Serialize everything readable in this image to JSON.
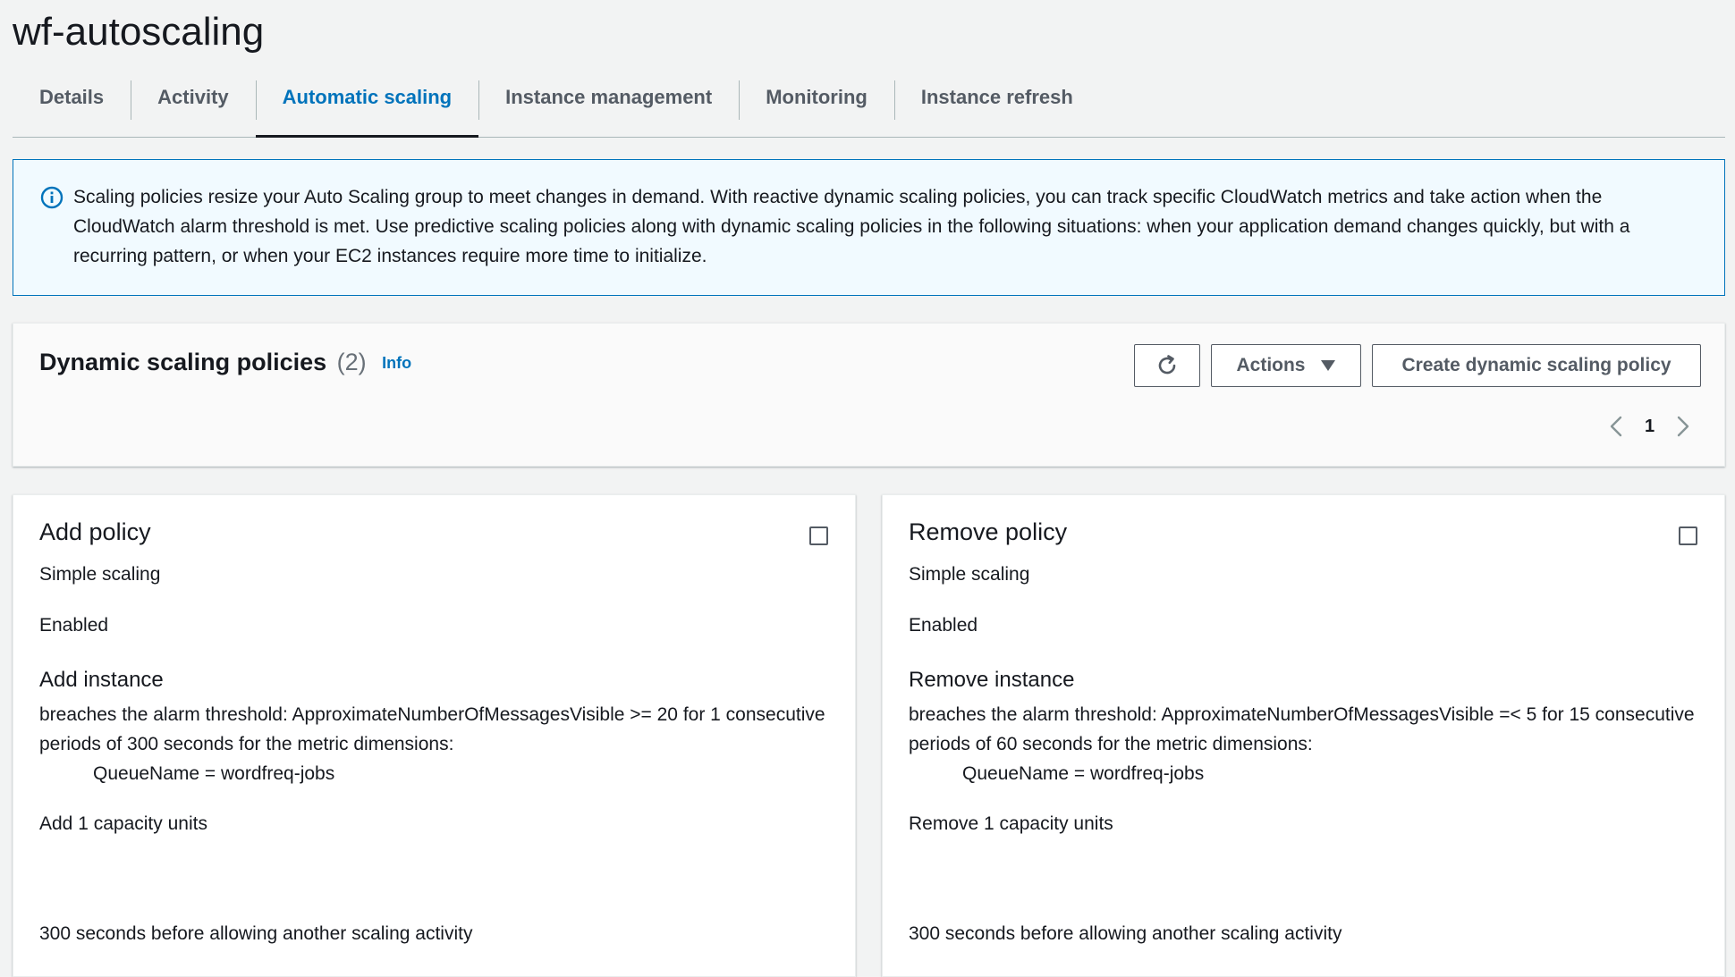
{
  "page": {
    "title": "wf-autoscaling"
  },
  "tabs": [
    {
      "label": "Details",
      "active": false
    },
    {
      "label": "Activity",
      "active": false
    },
    {
      "label": "Automatic scaling",
      "active": true
    },
    {
      "label": "Instance management",
      "active": false
    },
    {
      "label": "Monitoring",
      "active": false
    },
    {
      "label": "Instance refresh",
      "active": false
    }
  ],
  "info_alert": {
    "icon": "info-circle-icon",
    "text": "Scaling policies resize your Auto Scaling group to meet changes in demand. With reactive dynamic scaling policies, you can track specific CloudWatch metrics and take action when the CloudWatch alarm threshold is met. Use predictive scaling policies along with dynamic scaling policies in the following situations: when your application demand changes quickly, but with a recurring pattern, or when your EC2 instances require more time to initialize."
  },
  "policies_header": {
    "title": "Dynamic scaling policies",
    "count": "(2)",
    "info_link": "Info",
    "refresh_icon": "refresh-icon",
    "actions_label": "Actions",
    "create_label": "Create dynamic scaling policy",
    "pagination": {
      "current_page": "1"
    }
  },
  "policies": [
    {
      "title": "Add policy",
      "type": "Simple scaling",
      "status": "Enabled",
      "action_title": "Add instance",
      "breach_text": "breaches the alarm threshold: ApproximateNumberOfMessagesVisible >= 20 for 1 consecutive periods of 300 seconds for the metric dimensions:",
      "dimension": "QueueName = wordfreq-jobs",
      "capacity": "Add 1 capacity units",
      "cooldown": "300 seconds before allowing another scaling activity"
    },
    {
      "title": "Remove policy",
      "type": "Simple scaling",
      "status": "Enabled",
      "action_title": "Remove instance",
      "breach_text": "breaches the alarm threshold: ApproximateNumberOfMessagesVisible =< 5 for 15 consecutive periods of 60 seconds for the metric dimensions:",
      "dimension": "QueueName = wordfreq-jobs",
      "capacity": "Remove 1 capacity units",
      "cooldown": "300 seconds before allowing another scaling activity"
    }
  ],
  "colors": {
    "accent": "#0073bb",
    "text": "#16191f",
    "muted": "#545b64",
    "background": "#f2f3f3"
  }
}
